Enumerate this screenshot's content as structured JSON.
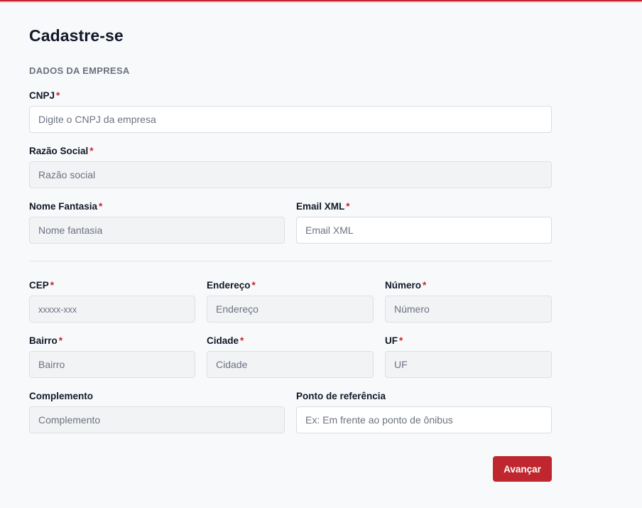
{
  "page": {
    "title": "Cadastre-se",
    "section": "DADOS DA EMPRESA"
  },
  "required_marker": "*",
  "fields": {
    "cnpj": {
      "label": "CNPJ",
      "placeholder": "Digite o CNPJ da empresa",
      "value": ""
    },
    "razao_social": {
      "label": "Razão Social",
      "placeholder": "Razão social",
      "value": ""
    },
    "nome_fantasia": {
      "label": "Nome Fantasia",
      "placeholder": "Nome fantasia",
      "value": ""
    },
    "email_xml": {
      "label": "Email XML",
      "placeholder": "Email XML",
      "value": ""
    },
    "cep": {
      "label": "CEP",
      "placeholder": "xxxxx-xxx",
      "value": ""
    },
    "endereco": {
      "label": "Endereço",
      "placeholder": "Endereço",
      "value": ""
    },
    "numero": {
      "label": "Número",
      "placeholder": "Número",
      "value": ""
    },
    "bairro": {
      "label": "Bairro",
      "placeholder": "Bairro",
      "value": ""
    },
    "cidade": {
      "label": "Cidade",
      "placeholder": "Cidade",
      "value": ""
    },
    "uf": {
      "label": "UF",
      "placeholder": "UF",
      "value": ""
    },
    "complemento": {
      "label": "Complemento",
      "placeholder": "Complemento",
      "value": ""
    },
    "ponto_referencia": {
      "label": "Ponto de referência",
      "placeholder": "Ex: Em frente ao ponto de ônibus",
      "value": ""
    }
  },
  "actions": {
    "next_label": "Avançar"
  },
  "colors": {
    "accent": "#c0262d",
    "background": "#f8f9fb",
    "disabled_input": "#f2f3f5"
  }
}
